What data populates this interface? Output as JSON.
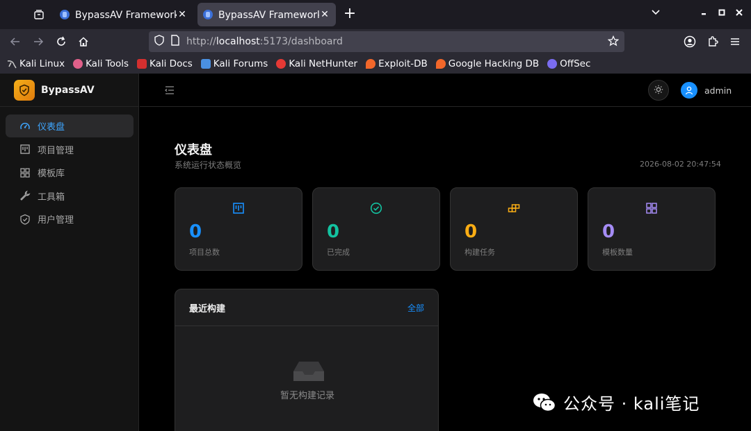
{
  "browser": {
    "tabs": [
      {
        "title": "BypassAV Framework - 免",
        "active": false
      },
      {
        "title": "BypassAV Framework - 免",
        "active": true
      }
    ],
    "url_prefix": "http://",
    "url_host": "localhost",
    "url_path": ":5173/dashboard",
    "bookmarks": [
      {
        "label": "Kali Linux",
        "icon": "kali-dragon-icon",
        "color": "#cccccc"
      },
      {
        "label": "Kali Tools",
        "icon": "kali-tools-icon",
        "color": "#e0608a"
      },
      {
        "label": "Kali Docs",
        "icon": "kali-docs-icon",
        "color": "#d32f2f"
      },
      {
        "label": "Kali Forums",
        "icon": "kali-forums-icon",
        "color": "#4a90e2"
      },
      {
        "label": "Kali NetHunter",
        "icon": "nethunter-icon",
        "color": "#e53935"
      },
      {
        "label": "Exploit-DB",
        "icon": "exploit-db-icon",
        "color": "#f2672a"
      },
      {
        "label": "Google Hacking DB",
        "icon": "ghdb-icon",
        "color": "#f2672a"
      },
      {
        "label": "OffSec",
        "icon": "offsec-icon",
        "color": "#7a6cf0"
      }
    ]
  },
  "app": {
    "brand": "BypassAV",
    "menu": [
      {
        "label": "仪表盘",
        "icon": "dashboard-icon",
        "active": true
      },
      {
        "label": "项目管理",
        "icon": "project-icon",
        "active": false
      },
      {
        "label": "模板库",
        "icon": "template-icon",
        "active": false
      },
      {
        "label": "工具箱",
        "icon": "wrench-icon",
        "active": false
      },
      {
        "label": "用户管理",
        "icon": "shield-user-icon",
        "active": false
      }
    ],
    "user": "admin",
    "page": {
      "title": "仪表盘",
      "subtitle": "系统运行状态概览",
      "time": "2026-08-02 20:47:54"
    },
    "stats": [
      {
        "value": "0",
        "label": "项目总数",
        "color": "#1890ff",
        "icon": "project-icon"
      },
      {
        "value": "0",
        "label": "已完成",
        "color": "#13c2a0",
        "icon": "check-circle-icon"
      },
      {
        "value": "0",
        "label": "构建任务",
        "color": "#faad14",
        "icon": "blocks-icon"
      },
      {
        "value": "0",
        "label": "模板数量",
        "color": "#a58cf5",
        "icon": "grid-icon"
      }
    ],
    "recent": {
      "title": "最近构建",
      "all": "全部",
      "empty": "暂无构建记录"
    }
  },
  "watermark": "公众号 · kali笔记",
  "colors": {
    "accent": "#1890ff",
    "brand": "#f5a623"
  }
}
